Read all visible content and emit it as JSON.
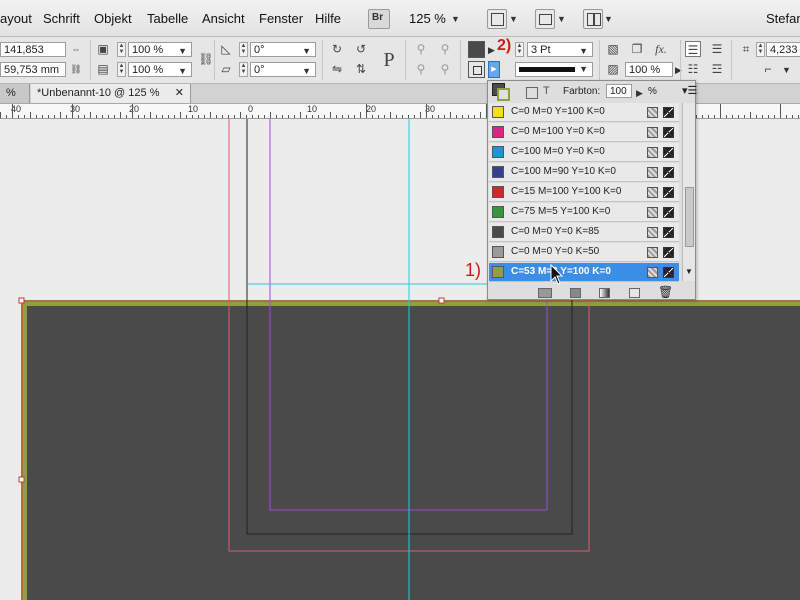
{
  "menubar": {
    "items": [
      "ayout",
      "Schrift",
      "Objekt",
      "Tabelle",
      "Ansicht",
      "Fenster",
      "Hilfe"
    ],
    "bridge_label": "Br",
    "zoom": "125 %",
    "user": "Stefan"
  },
  "control": {
    "x_value": "141,853 mm",
    "y_value": "59,753 mm",
    "scale_x": "100 %",
    "scale_y": "100 %",
    "rotation": "0°",
    "shear": "0°",
    "stroke_weight": "3 Pt",
    "opacity": "100 %",
    "right_value": "4,233",
    "fill_color": "#4a4a4a",
    "stroke_swatch_color": "#8fa043",
    "annotation_2": "2)"
  },
  "tabs": {
    "prev_label": "%",
    "active_label": "*Unbenannt-10 @ 125 %"
  },
  "ruler": {
    "labels": [
      "40",
      "30",
      "20",
      "10",
      "0",
      "10",
      "20",
      "30"
    ]
  },
  "swatches": {
    "tint_label": "Farbton:",
    "tint_value": "100",
    "tint_unit": "%",
    "text_icon_label": "T",
    "items": [
      {
        "label": "C=0 M=0 Y=100 K=0",
        "color": "#f4e012"
      },
      {
        "label": "C=0 M=100 Y=0 K=0",
        "color": "#e2237f"
      },
      {
        "label": "C=100 M=0 Y=0 K=0",
        "color": "#1995d8"
      },
      {
        "label": "C=100 M=90 Y=10 K=0",
        "color": "#34418e"
      },
      {
        "label": "C=15 M=100 Y=100 K=0",
        "color": "#cc2a2a"
      },
      {
        "label": "C=75 M=5 Y=100 K=0",
        "color": "#35963f"
      },
      {
        "label": "C=0 M=0 Y=0 K=85",
        "color": "#4a4a4a"
      },
      {
        "label": "C=0 M=0 Y=0 K=50",
        "color": "#9a9a9a"
      },
      {
        "label": "C=53 M=3 Y=100 K=0",
        "color": "#8fa043"
      }
    ],
    "selected_index": 8,
    "annotation_1": "1)"
  },
  "canvas": {
    "rect_fill": "#4a4a4a",
    "rect_stroke": "#8fa043",
    "accent": "#3b8ee6"
  }
}
